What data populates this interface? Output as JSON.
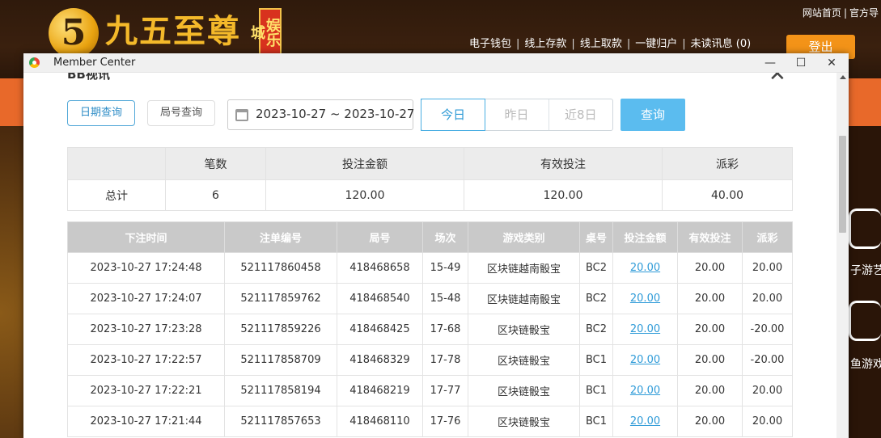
{
  "site": {
    "logo_digit": "5",
    "logo_name": "九五至尊",
    "logo_tag": "娱乐城",
    "top_links": [
      "网站首页",
      "官方导"
    ],
    "nav": [
      "电子钱包",
      "线上存款",
      "线上取款",
      "一键归户",
      "未读讯息 (0)"
    ],
    "logout": "登出",
    "side_labels": [
      "子游艺",
      "鱼游戏"
    ]
  },
  "window": {
    "title": "Member Center",
    "minimize": "—",
    "maximize": "☐",
    "close": "✕"
  },
  "section": {
    "title": "BB视讯",
    "close": "✕"
  },
  "filters": {
    "tab_date": "日期查询",
    "tab_round": "局号查询",
    "date_range": "2023-10-27 ~ 2023-10-27",
    "quick": [
      "今日",
      "昨日",
      "近8日"
    ],
    "query": "查询"
  },
  "summary": {
    "headers": [
      "",
      "笔数",
      "投注金额",
      "有效投注",
      "派彩"
    ],
    "row": [
      "总计",
      "6",
      "120.00",
      "120.00",
      "40.00"
    ]
  },
  "detail": {
    "headers": [
      "下注时间",
      "注单编号",
      "局号",
      "场次",
      "游戏类别",
      "桌号",
      "投注金额",
      "有效投注",
      "派彩"
    ],
    "rows": [
      [
        "2023-10-27 17:24:48",
        "521117860458",
        "418468658",
        "15-49",
        "区块链越南骰宝",
        "BC2",
        "20.00",
        "20.00",
        "20.00"
      ],
      [
        "2023-10-27 17:24:07",
        "521117859762",
        "418468540",
        "15-48",
        "区块链越南骰宝",
        "BC2",
        "20.00",
        "20.00",
        "20.00"
      ],
      [
        "2023-10-27 17:23:28",
        "521117859226",
        "418468425",
        "17-68",
        "区块链骰宝",
        "BC2",
        "20.00",
        "20.00",
        "-20.00"
      ],
      [
        "2023-10-27 17:22:57",
        "521117858709",
        "418468329",
        "17-78",
        "区块链骰宝",
        "BC1",
        "20.00",
        "20.00",
        "-20.00"
      ],
      [
        "2023-10-27 17:22:21",
        "521117858194",
        "418468219",
        "17-77",
        "区块链骰宝",
        "BC1",
        "20.00",
        "20.00",
        "20.00"
      ],
      [
        "2023-10-27 17:21:44",
        "521117857653",
        "418468110",
        "17-76",
        "区块链骰宝",
        "BC1",
        "20.00",
        "20.00",
        "20.00"
      ]
    ]
  },
  "colors": {
    "accent": "#5bbcef",
    "negative": "#e53b3b",
    "link": "#2f9bd8"
  }
}
